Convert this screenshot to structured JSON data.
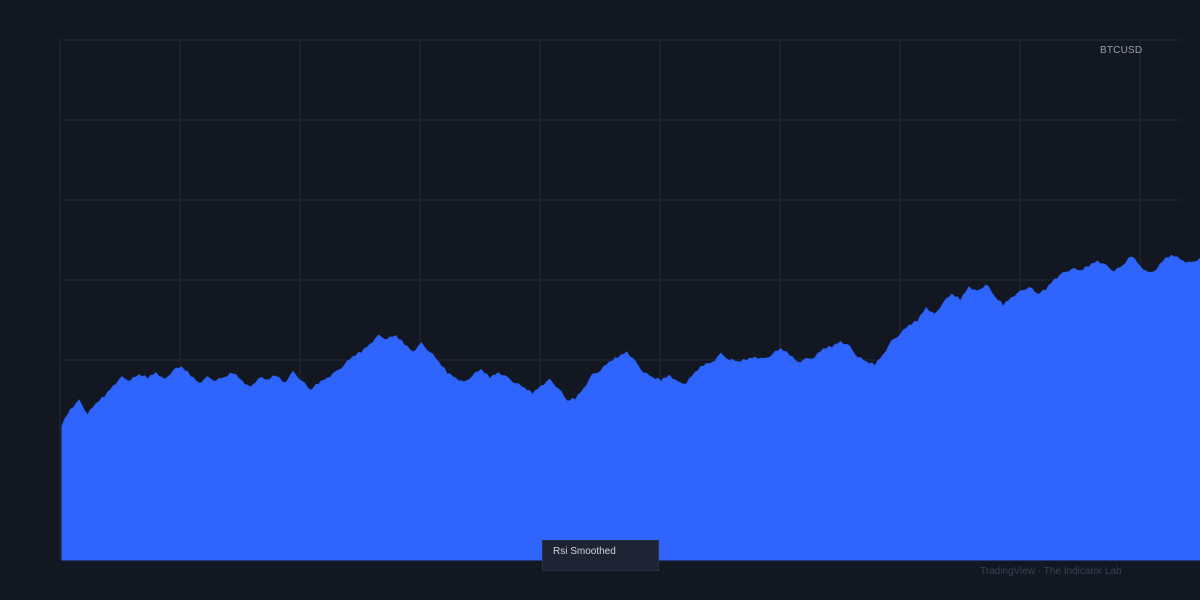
{
  "symbol": "BTCUSD",
  "legend": {
    "series_name": "Rsi Smoothed"
  },
  "credit": "TradingView · The Indicator Lab",
  "colors": {
    "background": "#131722",
    "grid": "#232837",
    "area_fill": "#2962ff",
    "area_fill_alt": "#2f64ff"
  },
  "chart_data": {
    "type": "area",
    "title": "",
    "xlabel": "",
    "ylabel": "",
    "ylim": [
      0,
      100
    ],
    "grid": true,
    "legend_position": "bottom-center",
    "series": [
      {
        "name": "Rsi Smoothed",
        "keypoints": [
          [
            0,
            26
          ],
          [
            1,
            29
          ],
          [
            2,
            30.5
          ],
          [
            3,
            28
          ],
          [
            4,
            30
          ],
          [
            5,
            31.5
          ],
          [
            6,
            33.5
          ],
          [
            7,
            35
          ],
          [
            8,
            34.5
          ],
          [
            9,
            35.5
          ],
          [
            10,
            35
          ],
          [
            11,
            36
          ],
          [
            12,
            34.5
          ],
          [
            13,
            36.5
          ],
          [
            14,
            37
          ],
          [
            15,
            35.5
          ],
          [
            16,
            34
          ],
          [
            17,
            35
          ],
          [
            18,
            34.5
          ],
          [
            19,
            35
          ],
          [
            20,
            36
          ],
          [
            21,
            34.5
          ],
          [
            22,
            33
          ],
          [
            23,
            35
          ],
          [
            24,
            34.5
          ],
          [
            25,
            35.5
          ],
          [
            26,
            34
          ],
          [
            27,
            36
          ],
          [
            28,
            34.5
          ],
          [
            29,
            32.5
          ],
          [
            30,
            34
          ],
          [
            31,
            35
          ],
          [
            32,
            36
          ],
          [
            33,
            37.5
          ],
          [
            34,
            39
          ],
          [
            35,
            40
          ],
          [
            36,
            41.5
          ],
          [
            37,
            43
          ],
          [
            38,
            42.5
          ],
          [
            39,
            43
          ],
          [
            40,
            41.5
          ],
          [
            41,
            40
          ],
          [
            42,
            41.5
          ],
          [
            43,
            40
          ],
          [
            44,
            38
          ],
          [
            45,
            36
          ],
          [
            46,
            35
          ],
          [
            47,
            34
          ],
          [
            48,
            35.5
          ],
          [
            49,
            36.5
          ],
          [
            50,
            35
          ],
          [
            51,
            36
          ],
          [
            52,
            35
          ],
          [
            53,
            34
          ],
          [
            54,
            33
          ],
          [
            55,
            32
          ],
          [
            56,
            33.5
          ],
          [
            57,
            34.5
          ],
          [
            58,
            33
          ],
          [
            59,
            30.5
          ],
          [
            60,
            31
          ],
          [
            61,
            33
          ],
          [
            62,
            35.5
          ],
          [
            63,
            36.5
          ],
          [
            64,
            38
          ],
          [
            65,
            39
          ],
          [
            66,
            40
          ],
          [
            67,
            38
          ],
          [
            68,
            36
          ],
          [
            69,
            35
          ],
          [
            70,
            34.5
          ],
          [
            71,
            35.5
          ],
          [
            72,
            34
          ],
          [
            73,
            34
          ],
          [
            74,
            36
          ],
          [
            75,
            37.5
          ],
          [
            76,
            38
          ],
          [
            77,
            39.5
          ],
          [
            78,
            38.5
          ],
          [
            79,
            38
          ],
          [
            80,
            38.5
          ],
          [
            81,
            39
          ],
          [
            82,
            38.5
          ],
          [
            83,
            39.5
          ],
          [
            84,
            40.5
          ],
          [
            85,
            39.5
          ],
          [
            86,
            38
          ],
          [
            87,
            38.5
          ],
          [
            88,
            39
          ],
          [
            89,
            40.5
          ],
          [
            90,
            41
          ],
          [
            91,
            42
          ],
          [
            92,
            41
          ],
          [
            93,
            39
          ],
          [
            94,
            38
          ],
          [
            95,
            37.5
          ],
          [
            96,
            39.5
          ],
          [
            97,
            42
          ],
          [
            98,
            43.5
          ],
          [
            99,
            45
          ],
          [
            100,
            46
          ],
          [
            101,
            48.5
          ],
          [
            102,
            47
          ],
          [
            103,
            49.5
          ],
          [
            104,
            51
          ],
          [
            105,
            50
          ],
          [
            106,
            52.5
          ],
          [
            107,
            51.5
          ],
          [
            108,
            53
          ],
          [
            109,
            50.5
          ],
          [
            110,
            49
          ],
          [
            111,
            50.5
          ],
          [
            112,
            51.5
          ],
          [
            113,
            52.5
          ],
          [
            114,
            51
          ],
          [
            115,
            52
          ],
          [
            116,
            54
          ],
          [
            117,
            55
          ],
          [
            118,
            56
          ],
          [
            119,
            55.5
          ],
          [
            120,
            56.5
          ],
          [
            121,
            57.5
          ],
          [
            122,
            56.5
          ],
          [
            123,
            55.5
          ],
          [
            124,
            56.5
          ],
          [
            125,
            58.5
          ],
          [
            126,
            56.5
          ],
          [
            127,
            55
          ],
          [
            128,
            56
          ],
          [
            129,
            58
          ],
          [
            130,
            58.5
          ],
          [
            131,
            57.5
          ],
          [
            132,
            57
          ],
          [
            133,
            58
          ]
        ]
      }
    ]
  }
}
